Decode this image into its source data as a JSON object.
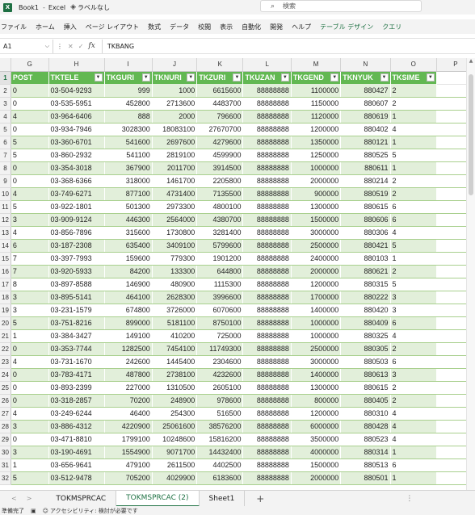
{
  "titlebar": {
    "logo": "X",
    "book_title": "Book1",
    "separator": "-",
    "app_name": "Excel",
    "label_icon": "label-icon",
    "label_text": "ラベルなし",
    "search_placeholder": "検索"
  },
  "menu": [
    "ファイル",
    "ホーム",
    "挿入",
    "ページ レイアウト",
    "数式",
    "データ",
    "校閲",
    "表示",
    "自動化",
    "開発",
    "ヘルプ",
    "テーブル デザイン",
    "クエリ"
  ],
  "formula_bar": {
    "name_box": "A1",
    "fx": "fx",
    "content": "TKBANG"
  },
  "columns": [
    {
      "letter": "G",
      "header": "POST",
      "filter": false
    },
    {
      "letter": "H",
      "header": "TKTELE",
      "filter": true
    },
    {
      "letter": "I",
      "header": "TKGURI",
      "filter": true
    },
    {
      "letter": "J",
      "header": "TKNURI",
      "filter": true
    },
    {
      "letter": "K",
      "header": "TKZURI",
      "filter": true
    },
    {
      "letter": "L",
      "header": "TKUZAN",
      "filter": true
    },
    {
      "letter": "M",
      "header": "TKGEND",
      "filter": true
    },
    {
      "letter": "N",
      "header": "TKNYUK",
      "filter": true
    },
    {
      "letter": "O",
      "header": "TKSIME",
      "filter": true
    },
    {
      "letter": "P",
      "header": "",
      "filter": false
    }
  ],
  "rows": [
    {
      "n": "2",
      "c": [
        "0",
        "03-504-9293",
        "999",
        "1000",
        "6615600",
        "88888888",
        "1100000",
        "880427",
        "2"
      ]
    },
    {
      "n": "3",
      "c": [
        "0",
        "03-535-5951",
        "452800",
        "2713600",
        "4483700",
        "88888888",
        "1150000",
        "880607",
        "2"
      ]
    },
    {
      "n": "4",
      "c": [
        "4",
        "03-964-6406",
        "888",
        "2000",
        "796600",
        "88888888",
        "1120000",
        "880619",
        "1"
      ]
    },
    {
      "n": "5",
      "c": [
        "0",
        "03-934-7946",
        "3028300",
        "18083100",
        "27670700",
        "88888888",
        "1200000",
        "880402",
        "4"
      ]
    },
    {
      "n": "6",
      "c": [
        "5",
        "03-360-6701",
        "541600",
        "2697600",
        "4279600",
        "88888888",
        "1350000",
        "880121",
        "1"
      ]
    },
    {
      "n": "7",
      "c": [
        "5",
        "03-860-2932",
        "541100",
        "2819100",
        "4599900",
        "88888888",
        "1250000",
        "880525",
        "5"
      ]
    },
    {
      "n": "8",
      "c": [
        "0",
        "03-354-3018",
        "367900",
        "2011700",
        "3914500",
        "88888888",
        "1000000",
        "880611",
        "1"
      ]
    },
    {
      "n": "9",
      "c": [
        "0",
        "03-368-6366",
        "318000",
        "1461700",
        "2205800",
        "88888888",
        "2000000",
        "880214",
        "2"
      ]
    },
    {
      "n": "10",
      "c": [
        "4",
        "03-749-6271",
        "877100",
        "4731400",
        "7135500",
        "88888888",
        "900000",
        "880519",
        "2"
      ]
    },
    {
      "n": "11",
      "c": [
        "5",
        "03-922-1801",
        "501300",
        "2973300",
        "4800100",
        "88888888",
        "1300000",
        "880615",
        "6"
      ]
    },
    {
      "n": "12",
      "c": [
        "3",
        "03-909-9124",
        "446300",
        "2564000",
        "4380700",
        "88888888",
        "1500000",
        "880606",
        "6"
      ]
    },
    {
      "n": "13",
      "c": [
        "4",
        "03-856-7896",
        "315600",
        "1730800",
        "3281400",
        "88888888",
        "3000000",
        "880306",
        "4"
      ]
    },
    {
      "n": "14",
      "c": [
        "6",
        "03-187-2308",
        "635400",
        "3409100",
        "5799600",
        "88888888",
        "2500000",
        "880421",
        "5"
      ]
    },
    {
      "n": "15",
      "c": [
        "7",
        "03-397-7993",
        "159600",
        "779300",
        "1901200",
        "88888888",
        "2400000",
        "880103",
        "1"
      ]
    },
    {
      "n": "16",
      "c": [
        "7",
        "03-920-5933",
        "84200",
        "133300",
        "644800",
        "88888888",
        "2000000",
        "880621",
        "2"
      ]
    },
    {
      "n": "17",
      "c": [
        "8",
        "03-897-8588",
        "146900",
        "480900",
        "1115300",
        "88888888",
        "1200000",
        "880315",
        "5"
      ]
    },
    {
      "n": "18",
      "c": [
        "3",
        "03-895-5141",
        "464100",
        "2628300",
        "3996600",
        "88888888",
        "1700000",
        "880222",
        "3"
      ]
    },
    {
      "n": "19",
      "c": [
        "3",
        "03-231-1579",
        "674800",
        "3726000",
        "6070600",
        "88888888",
        "1400000",
        "880420",
        "3"
      ]
    },
    {
      "n": "20",
      "c": [
        "5",
        "03-751-8216",
        "899000",
        "5181100",
        "8750100",
        "88888888",
        "1000000",
        "880409",
        "6"
      ]
    },
    {
      "n": "21",
      "c": [
        "1",
        "03-384-3427",
        "149100",
        "410200",
        "725000",
        "88888888",
        "1000000",
        "880325",
        "4"
      ]
    },
    {
      "n": "22",
      "c": [
        "0",
        "03-353-7744",
        "1282500",
        "7454100",
        "11749300",
        "88888888",
        "2500000",
        "880305",
        "2"
      ]
    },
    {
      "n": "23",
      "c": [
        "4",
        "03-731-1670",
        "242600",
        "1445400",
        "2304600",
        "88888888",
        "3000000",
        "880503",
        "6"
      ]
    },
    {
      "n": "24",
      "c": [
        "0",
        "03-783-4171",
        "487800",
        "2738100",
        "4232600",
        "88888888",
        "1400000",
        "880613",
        "3"
      ]
    },
    {
      "n": "25",
      "c": [
        "0",
        "03-893-2399",
        "227000",
        "1310500",
        "2605100",
        "88888888",
        "1300000",
        "880615",
        "2"
      ]
    },
    {
      "n": "26",
      "c": [
        "0",
        "03-318-2857",
        "70200",
        "248900",
        "978600",
        "88888888",
        "800000",
        "880405",
        "2"
      ]
    },
    {
      "n": "27",
      "c": [
        "4",
        "03-249-6244",
        "46400",
        "254300",
        "516500",
        "88888888",
        "1200000",
        "880310",
        "4"
      ]
    },
    {
      "n": "28",
      "c": [
        "3",
        "03-886-4312",
        "4220900",
        "25061600",
        "38576200",
        "88888888",
        "6000000",
        "880428",
        "4"
      ]
    },
    {
      "n": "29",
      "c": [
        "0",
        "03-471-8810",
        "1799100",
        "10248600",
        "15816200",
        "88888888",
        "3500000",
        "880523",
        "4"
      ]
    },
    {
      "n": "30",
      "c": [
        "3",
        "03-190-4691",
        "1554900",
        "9071700",
        "14432400",
        "88888888",
        "4000000",
        "880314",
        "1"
      ]
    },
    {
      "n": "31",
      "c": [
        "1",
        "03-656-9641",
        "479100",
        "2611500",
        "4402500",
        "88888888",
        "1500000",
        "880513",
        "6"
      ]
    },
    {
      "n": "32",
      "c": [
        "5",
        "03-512-9478",
        "705200",
        "4029900",
        "6183600",
        "88888888",
        "2000000",
        "880501",
        "1"
      ]
    }
  ],
  "sheet_tabs": {
    "nav_prev": "<",
    "nav_next": ">",
    "tabs": [
      {
        "label": "TOKMSPRCAC",
        "active": false
      },
      {
        "label": "TOKMSPRCAC (2)",
        "active": true
      },
      {
        "label": "Sheet1",
        "active": false
      }
    ],
    "add": "+",
    "more": "⋮"
  },
  "status": {
    "ready": "準備完了",
    "accessibility": "アクセシビリティ: 検討が必要です"
  },
  "colors": {
    "accent": "#1f7244",
    "header_fill": "#62b852",
    "band_fill": "#e2efda"
  }
}
